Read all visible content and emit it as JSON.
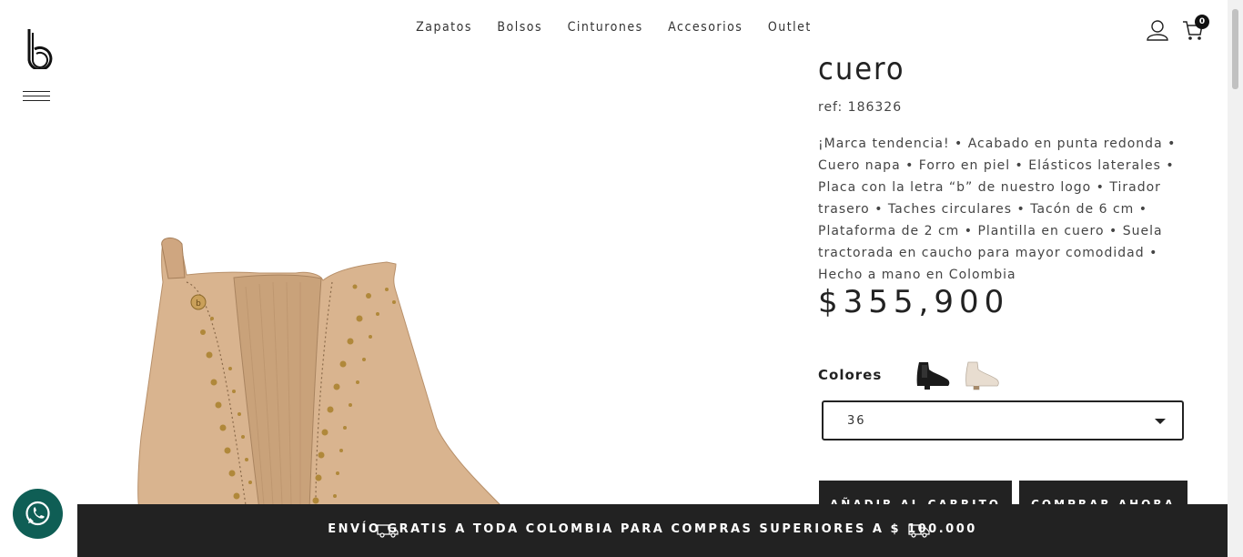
{
  "nav": {
    "items": [
      {
        "label": "Zapatos"
      },
      {
        "label": "Bolsos"
      },
      {
        "label": "Cinturones"
      },
      {
        "label": "Accesorios"
      },
      {
        "label": "Outlet"
      }
    ]
  },
  "cart": {
    "count": "0"
  },
  "product": {
    "title": "cuero",
    "ref": "ref: 186326",
    "description": "¡Marca tendencia! • Acabado en punta redonda • Cuero napa • Forro en piel • Elásticos laterales • Placa con la letra “b” de nuestro logo • Tirador trasero • Taches circulares • Tacón de 6 cm • Plataforma de 2 cm • Plantilla en cuero • Suela tractorada en caucho para mayor comodidad • Hecho a mano en Colombia",
    "price": "$355,900",
    "colors_label": "Colores",
    "color_swatches": [
      "black-boot-icon",
      "cream-boot-icon"
    ],
    "size_selected": "36"
  },
  "buttons": {
    "add_to_cart": "AÑADIR AL CARRITO",
    "buy_now": "COMPRAR AHORA"
  },
  "shipping": {
    "text": "ENVÍO GRATIS A TODA COLOMBIA PARA COMPRAS SUPERIORES A $ 100.000"
  },
  "colors": {
    "dark": "#222222",
    "product_tan": "#d9b48f",
    "whatsapp": "#0f5e55"
  }
}
